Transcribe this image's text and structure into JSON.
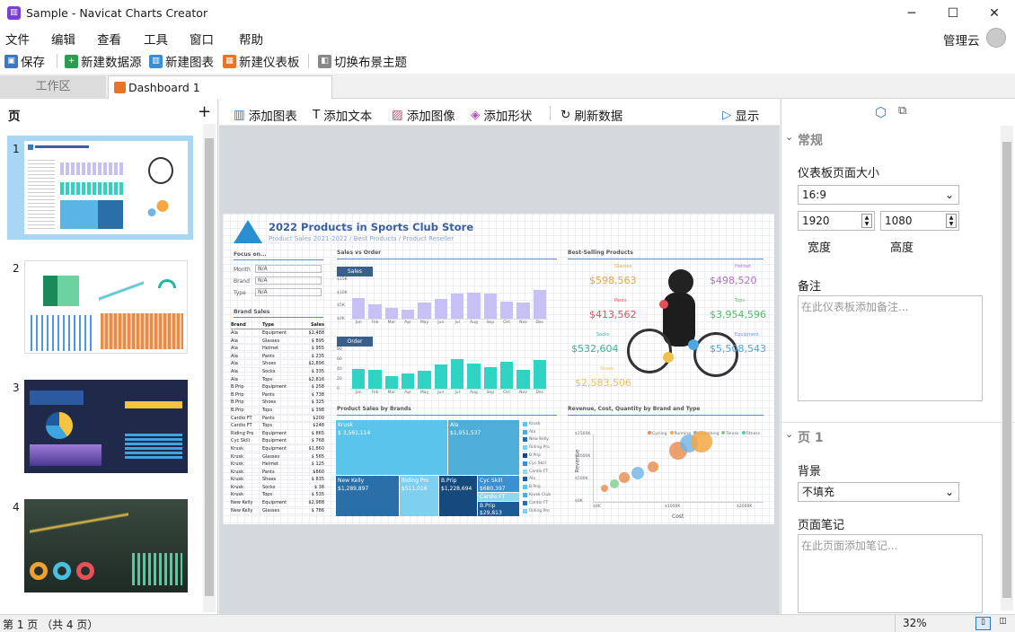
{
  "window": {
    "title": "Sample - Navicat Charts Creator",
    "min": "─",
    "max": "☐",
    "close": "✕"
  },
  "menu": [
    "文件",
    "编辑",
    "查看",
    "工具",
    "窗口",
    "帮助"
  ],
  "user": {
    "name": "管理云"
  },
  "toolbar": {
    "save": "保存",
    "new_datasource": "新建数据源",
    "new_chart": "新建图表",
    "new_dashboard": "新建仪表板",
    "switch_theme": "切换布景主题"
  },
  "tabs": {
    "workspace": "工作区",
    "dashboard": "Dashboard 1"
  },
  "pages": {
    "title": "页",
    "add": "+",
    "items": [
      "1",
      "2",
      "3",
      "4"
    ]
  },
  "canvas_toolbar": {
    "add_chart": "添加图表",
    "add_text": "添加文本",
    "add_image": "添加图像",
    "add_shape": "添加形状",
    "refresh": "刷新数据",
    "show": "显示"
  },
  "dashboard": {
    "title": "2022 Products in Sports Club Store",
    "subtitle": "Product Sales 2021-2022 / Best Products / Product Reseller",
    "focus": {
      "title": "Focus on...",
      "month": "Month",
      "brand": "Brand",
      "type": "Type",
      "all": "N/A"
    },
    "brand_sales": {
      "title": "Brand Sales",
      "cols": [
        "Brand",
        "Type",
        "Sales"
      ],
      "rows": [
        [
          "Ala",
          "Equipment",
          "$2,488"
        ],
        [
          "Ala",
          "Glasses",
          "$ 895"
        ],
        [
          "Ala",
          "Helmet",
          "$ 955"
        ],
        [
          "Ala",
          "Pants",
          "$ 235"
        ],
        [
          "Ala",
          "Shoes",
          "$2,896"
        ],
        [
          "Ala",
          "Socks",
          "$ 335"
        ],
        [
          "Ala",
          "Tops",
          "$2,816"
        ],
        [
          "B.Prip",
          "Equipment",
          "$ 258"
        ],
        [
          "B.Prip",
          "Pants",
          "$ 738"
        ],
        [
          "B.Prip",
          "Shoes",
          "$ 325"
        ],
        [
          "B.Prip",
          "Tops",
          "$ 398"
        ],
        [
          "Cardio FT",
          "Pants",
          "$200"
        ],
        [
          "Cardio FT",
          "Tops",
          "$248"
        ],
        [
          "Riding Pro",
          "Equipment",
          "$ 865"
        ],
        [
          "Cyc Skill",
          "Equipment",
          "$ 768"
        ],
        [
          "Krusk",
          "Equipment",
          "$1,860"
        ],
        [
          "Krusk",
          "Glasses",
          "$ 565"
        ],
        [
          "Krusk",
          "Helmet",
          "$ 125"
        ],
        [
          "Krusk",
          "Pants",
          "$860"
        ],
        [
          "Krusk",
          "Shoes",
          "$ 835"
        ],
        [
          "Krusk",
          "Socks",
          "$ 38"
        ],
        [
          "Krusk",
          "Tops",
          "$ 535"
        ],
        [
          "New Kelly",
          "Equipment",
          "$2,988"
        ],
        [
          "New Kelly",
          "Glasses",
          "$ 786"
        ]
      ]
    },
    "sales_vs_order": {
      "title": "Sales vs Order",
      "sales_btn": "Sales",
      "order_btn": "Order",
      "months": [
        "Jan",
        "Feb",
        "Mar",
        "Apr",
        "May",
        "Jun",
        "Jul",
        "Aug",
        "Sep",
        "Oct",
        "Nov",
        "Dec"
      ],
      "sales_ticks": [
        "$15K",
        "$10K",
        "$5K",
        "$0K"
      ],
      "order_ticks": [
        "80",
        "60",
        "40",
        "20",
        "0"
      ]
    },
    "best": {
      "title": "Best-Selling Products",
      "items": [
        {
          "name": "Glasses",
          "value": "$598,563",
          "color": "#e8a24a"
        },
        {
          "name": "Helmet",
          "value": "$498,520",
          "color": "#b56fc4"
        },
        {
          "name": "Pants",
          "value": "$413,562",
          "color": "#e0505a"
        },
        {
          "name": "Tops",
          "value": "$3,954,596",
          "color": "#4cbf6a"
        },
        {
          "name": "Socks",
          "value": "$532,604",
          "color": "#35b49a"
        },
        {
          "name": "Equipment",
          "value": "$5,508,543",
          "color": "#4aa8e0"
        },
        {
          "name": "Shoes",
          "value": "$2,583,506",
          "color": "#f0c050"
        }
      ]
    },
    "treemap": {
      "title": "Product Sales by Brands",
      "cells": [
        {
          "label": "Krusk",
          "value": "$ 3,561,114"
        },
        {
          "label": "Ala",
          "value": "$1,951,537"
        },
        {
          "label": "New Kelly",
          "value": "$1,289,897"
        },
        {
          "label": "Riding Pro",
          "value": "$511,016"
        },
        {
          "label": "B.Prip",
          "value": "$1,228,694"
        },
        {
          "label": "Cyc Skill",
          "value": "$680,397"
        },
        {
          "label": "Cardio FT",
          "value": ""
        },
        {
          "label": "B.Prip",
          "value": "$29,813"
        }
      ],
      "legend": [
        "Krusk",
        "Ala",
        "New Kelly",
        "Riding Pro",
        "B.Prip",
        "Cyc Skill",
        "Cardio FT",
        "Ala",
        "B.Prip",
        "Krusk Club",
        "Cardio FT",
        "Riding Pro"
      ]
    },
    "scatter": {
      "title": "Revenue, Cost, Quantity by Brand and Type",
      "xlabel": "Cost",
      "ylabel": "Revenue",
      "legend": [
        "Cycling",
        "Running",
        "Swimming",
        "Tennis",
        "Fitness"
      ],
      "yticks": [
        "$1500K",
        "$1000K",
        "$500K",
        "$0K"
      ],
      "xticks": [
        "$0K",
        "$1000K",
        "$2000K"
      ]
    }
  },
  "props": {
    "general": "常规",
    "page_size": "仪表板页面大小",
    "ratio": "16:9",
    "width": "1920",
    "height": "1080",
    "width_label": "宽度",
    "height_label": "高度",
    "notes": "备注",
    "notes_ph": "在此仪表板添加备注...",
    "page": "页 1",
    "background": "背景",
    "bg_value": "不填充",
    "page_notes": "页面笔记",
    "page_notes_ph": "在此页面添加笔记..."
  },
  "status": {
    "text": "第 1 页 （共 4 页）",
    "zoom": "32%"
  },
  "chart_data": [
    {
      "type": "bar",
      "title": "Sales",
      "categories": [
        "Jan",
        "Feb",
        "Mar",
        "Apr",
        "May",
        "Jun",
        "Jul",
        "Aug",
        "Sep",
        "Oct",
        "Nov",
        "Dec"
      ],
      "values": [
        8000,
        5500,
        4000,
        3500,
        6000,
        7500,
        9500,
        10000,
        9500,
        6500,
        6000,
        11000
      ],
      "ylim": [
        0,
        15000
      ]
    },
    {
      "type": "bar",
      "title": "Order",
      "categories": [
        "Jan",
        "Feb",
        "Mar",
        "Apr",
        "May",
        "Jun",
        "Jul",
        "Aug",
        "Sep",
        "Oct",
        "Nov",
        "Dec"
      ],
      "values": [
        40,
        38,
        25,
        31,
        36,
        50,
        60,
        51,
        44,
        55,
        39,
        58
      ],
      "ylim": [
        0,
        80
      ]
    }
  ]
}
